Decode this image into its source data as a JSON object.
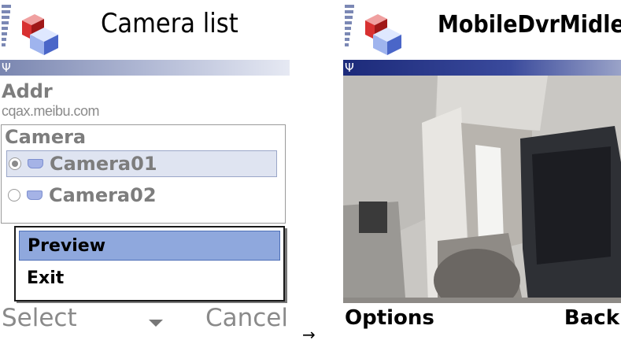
{
  "left_screen": {
    "title": "Camera list",
    "addr_label": "Addr",
    "addr_value": "cqax.meibu.com",
    "camera_label": "Camera",
    "cameras": [
      {
        "name": "Camera01",
        "selected": true
      },
      {
        "name": "Camera02",
        "selected": false
      }
    ],
    "menu": [
      {
        "label": "Preview",
        "highlighted": true
      },
      {
        "label": "Exit",
        "highlighted": false
      }
    ],
    "softkeys": {
      "left": "Select",
      "right": "Cancel"
    }
  },
  "arrow": "→",
  "right_screen": {
    "title": "MobileDvrMidlet",
    "softkeys": {
      "left": "Options",
      "right": "Back"
    }
  },
  "colors": {
    "title_gradient_start": "#7a86b0",
    "menu_highlight": "#8fa8dd",
    "selected_row": "#dfe4f1"
  },
  "icons": [
    "signal-strength-icon",
    "app-cubes-icon",
    "antenna-icon",
    "radio-icon",
    "camera-icon",
    "chevron-down-icon"
  ]
}
